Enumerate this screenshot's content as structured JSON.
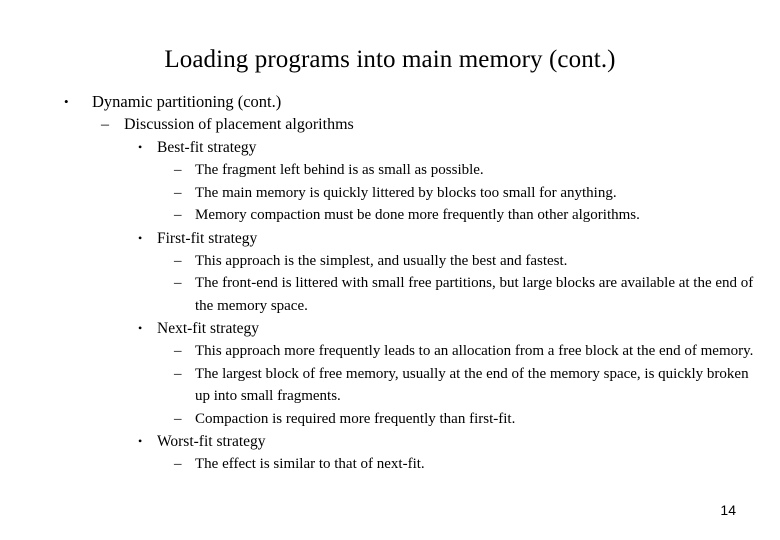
{
  "slide": {
    "title": "Loading programs into main memory (cont.)",
    "page_number": "14",
    "markers": {
      "disc": "•",
      "dash": "–"
    },
    "outline": [
      {
        "level": 1,
        "marker": "•",
        "text": "Dynamic partitioning (cont.)"
      },
      {
        "level": 2,
        "marker": "–",
        "text": "Discussion of placement algorithms"
      },
      {
        "level": 3,
        "marker": "•",
        "text": "Best-fit strategy"
      },
      {
        "level": 4,
        "marker": "–",
        "text": "The fragment left behind is as small as possible."
      },
      {
        "level": 4,
        "marker": "–",
        "text": "The main memory is quickly littered by blocks too small for anything."
      },
      {
        "level": 4,
        "marker": "–",
        "text": "Memory compaction must be done more frequently than other algorithms."
      },
      {
        "level": 3,
        "marker": "•",
        "text": "First-fit strategy"
      },
      {
        "level": 4,
        "marker": "–",
        "text": "This approach is the simplest, and usually the best and fastest."
      },
      {
        "level": 4,
        "marker": "–",
        "text": "The front-end is littered with small free partitions, but large blocks are available at the end of the memory space."
      },
      {
        "level": 3,
        "marker": "•",
        "text": "Next-fit strategy"
      },
      {
        "level": 4,
        "marker": "–",
        "text": "This approach more frequently leads to an allocation from a free block at the end of memory."
      },
      {
        "level": 4,
        "marker": "–",
        "text": "The largest block of free memory, usually at the end of the memory space, is quickly broken up into small fragments."
      },
      {
        "level": 4,
        "marker": "–",
        "text": "Compaction is required more frequently than first-fit."
      },
      {
        "level": 3,
        "marker": "•",
        "text": "Worst-fit strategy"
      },
      {
        "level": 4,
        "marker": "–",
        "text": "The effect is similar to that of next-fit."
      }
    ]
  },
  "colors": {
    "background": "#ffffff",
    "text": "#000000"
  }
}
